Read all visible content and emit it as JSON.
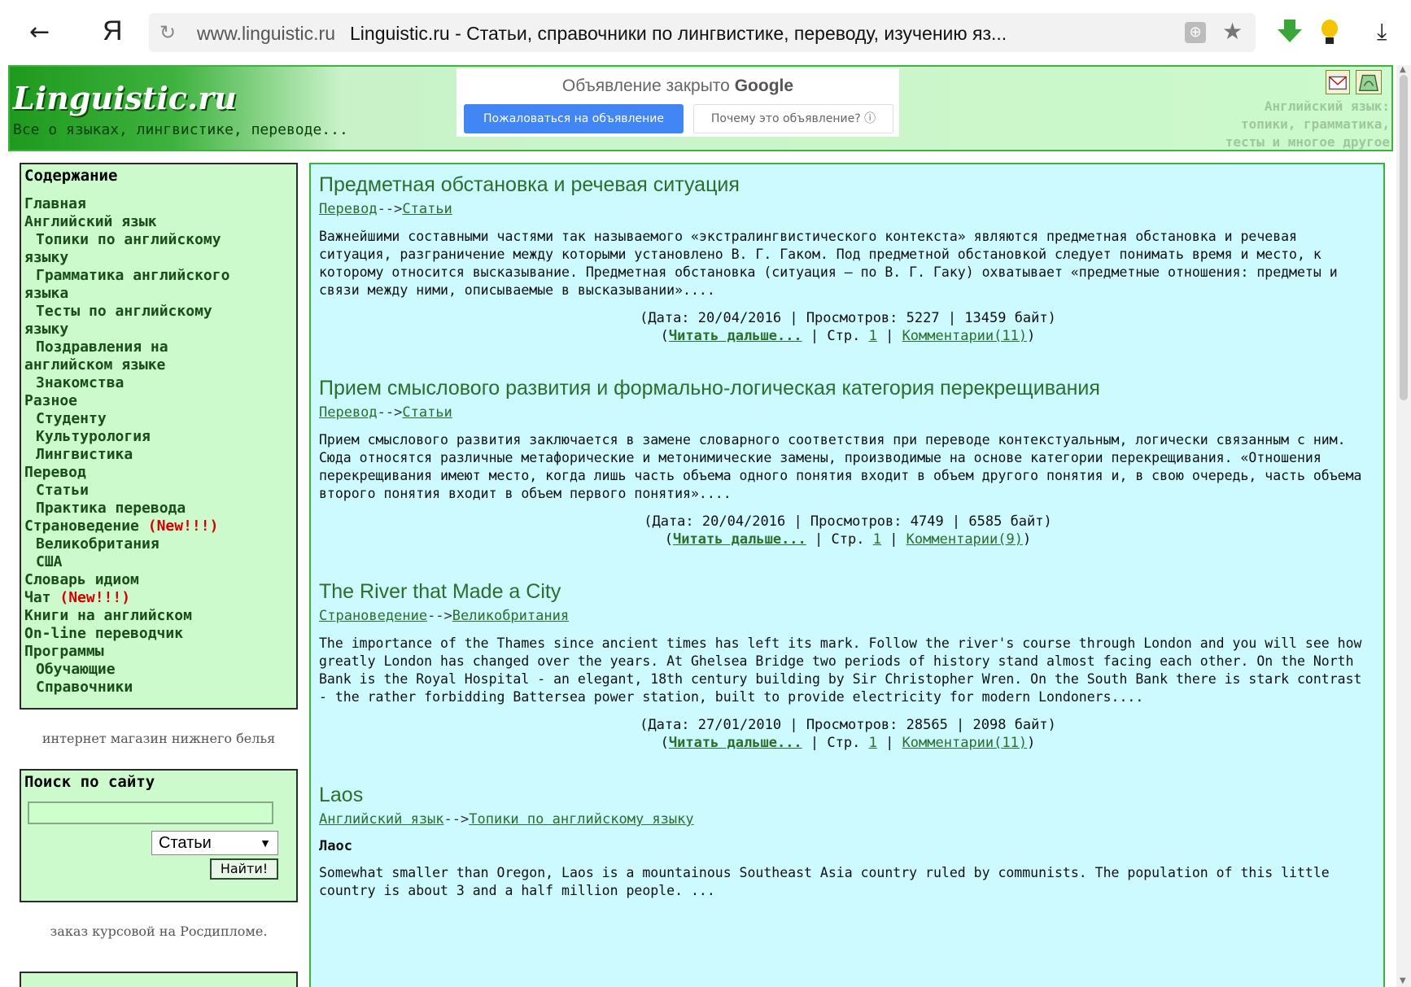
{
  "browser": {
    "back_icon": "←",
    "yandex_logo": "Я",
    "reload_icon": "↻",
    "domain": "www.linguistic.ru",
    "title": "Linguistic.ru - Статьи, справочники по лингвистике, переводу, изучению яз...",
    "star_icon": "★",
    "download_icon": "⤓"
  },
  "header": {
    "site_title": "Linguistic.ru",
    "tagline": "Все о языках, лингвистике, переводе...",
    "ad_closed_text": "Объявление закрыто",
    "ad_closed_brand": "Google",
    "ad_report_button": "Пожаловаться на объявление",
    "ad_why_button": "Почему это объявление? ⓘ",
    "right_promo": [
      "Английский язык:",
      "топики, грамматика,",
      "тесты и многое другое"
    ]
  },
  "nav": {
    "heading": "Содержание",
    "items": [
      {
        "label": "Главная",
        "sub": false
      },
      {
        "label": "Английский язык",
        "sub": false
      },
      {
        "label": "Топики по английскому",
        "sub": true
      },
      {
        "label": "языку",
        "sub": false
      },
      {
        "label": "Грамматика английского",
        "sub": true
      },
      {
        "label": "языка",
        "sub": false
      },
      {
        "label": "Тесты по английскому",
        "sub": true
      },
      {
        "label": "языку",
        "sub": false
      },
      {
        "label": "Поздравления на",
        "sub": true
      },
      {
        "label": "английском языке",
        "sub": false
      },
      {
        "label": "Знакомства",
        "sub": true
      },
      {
        "label": "Разное",
        "sub": false
      },
      {
        "label": "Студенту",
        "sub": true
      },
      {
        "label": "Культурология",
        "sub": true
      },
      {
        "label": "Лингвистика",
        "sub": true
      },
      {
        "label": "Перевод",
        "sub": false
      },
      {
        "label": "Статьи",
        "sub": true
      },
      {
        "label": "Практика перевода",
        "sub": true
      },
      {
        "label": "Страноведение",
        "sub": false,
        "new": "(New!!!)"
      },
      {
        "label": "Великобритания",
        "sub": true
      },
      {
        "label": "США",
        "sub": true
      },
      {
        "label": "Словарь идиом",
        "sub": false
      },
      {
        "label": "Чат",
        "sub": false,
        "new": "(New!!!)"
      },
      {
        "label": "Книги на английском",
        "sub": false
      },
      {
        "label": "On-line переводчик",
        "sub": false
      },
      {
        "label": "Программы",
        "sub": false
      },
      {
        "label": "Обучающие",
        "sub": true
      },
      {
        "label": "Справочники",
        "sub": true
      }
    ]
  },
  "sidebar": {
    "ad_link_1": "интернет магазин нижнего белья",
    "search_heading": "Поиск по сайту",
    "search_value": "",
    "search_select": "Статьи",
    "search_select_arrow": "▼",
    "search_button": "Найти!",
    "ad_link_2": "заказ курсовой на Росдипломе."
  },
  "articles": [
    {
      "title": "Предметная обстановка и речевая ситуация",
      "crumb_1": "Перевод",
      "crumb_sep": "-->",
      "crumb_2": "Статьи",
      "body": "Важнейшими составными частями так называемого «экстралингвистического контекста» являются предметная обстановка и речевая ситуация, разграничение между которыми установлено В. Г. Гаком. Под предметной обстановкой следует понимать время и место, к которому относится высказывание. Предметная обстановка (ситуация — по В. Г. Гаку) охватывает «предметные отношения: предметы и связи между ними, описываемые в высказывании»....",
      "meta": "(Дата: 20/04/2016 | Просмотров: 5227 | 13459 байт)",
      "more": "Читать дальше...",
      "page_label": "| Стр.",
      "page": "1",
      "comments": "Комментарии(11)"
    },
    {
      "title": "Прием смыслового развития и формально-логическая категория перекрещивания",
      "crumb_1": "Перевод",
      "crumb_sep": "-->",
      "crumb_2": "Статьи",
      "body": "Прием смыслового развития заключается в замене словарного соответствия при переводе контекстуальным, логически связанным с ним. Сюда относятся различные метафорические и метонимические замены, производимые на основе категории перекрещивания. «Отношения перекрещивания имеют место, когда лишь часть объема одного понятия входит в объем другого понятия и, в свою очередь, часть объема второго понятия входит в объем первого понятия»....",
      "meta": "(Дата: 20/04/2016 | Просмотров: 4749 | 6585 байт)",
      "more": "Читать дальше...",
      "page_label": "| Стр.",
      "page": "1",
      "comments": "Комментарии(9)"
    },
    {
      "title": "The River that Made a City",
      "crumb_1": "Страноведение",
      "crumb_sep": "-->",
      "crumb_2": "Великобритания",
      "body": "The importance of the Thames since ancient times has left its mark. Follow the river's course through London and you will see how greatly London has changed over the years. At Ghelsea Bridge two periods of history stand almost facing each other. On the North Bank is the Royal Hospital - an elegant, 18th century building by Sir Christopher Wren. On the South Bank there is stark contrast - the rather forbidding Battersea power station, built to provide electricity for modern Londoners....",
      "meta": "(Дата: 27/01/2010 | Просмотров: 28565 | 2098 байт)",
      "more": "Читать дальше...",
      "page_label": "| Стр.",
      "page": "1",
      "comments": "Комментарии(11)"
    },
    {
      "title": "Laos",
      "crumb_1": "Английский язык",
      "crumb_sep": "-->",
      "crumb_2": "Топики по английскому языку",
      "subhead": "Лаос",
      "body": "Somewhat smaller than Oregon, Laos is a mountainous Southeast Asia country ruled by communists. The population of this little country is about 3 and a half million people. ..."
    }
  ],
  "colors": {
    "header_green": "#3cb43c",
    "nav_bg": "#ccfacc",
    "main_bg": "#ccfaff",
    "link_green": "#2c6e2c",
    "new_red": "#d40000",
    "ad_blue": "#4285f4"
  }
}
